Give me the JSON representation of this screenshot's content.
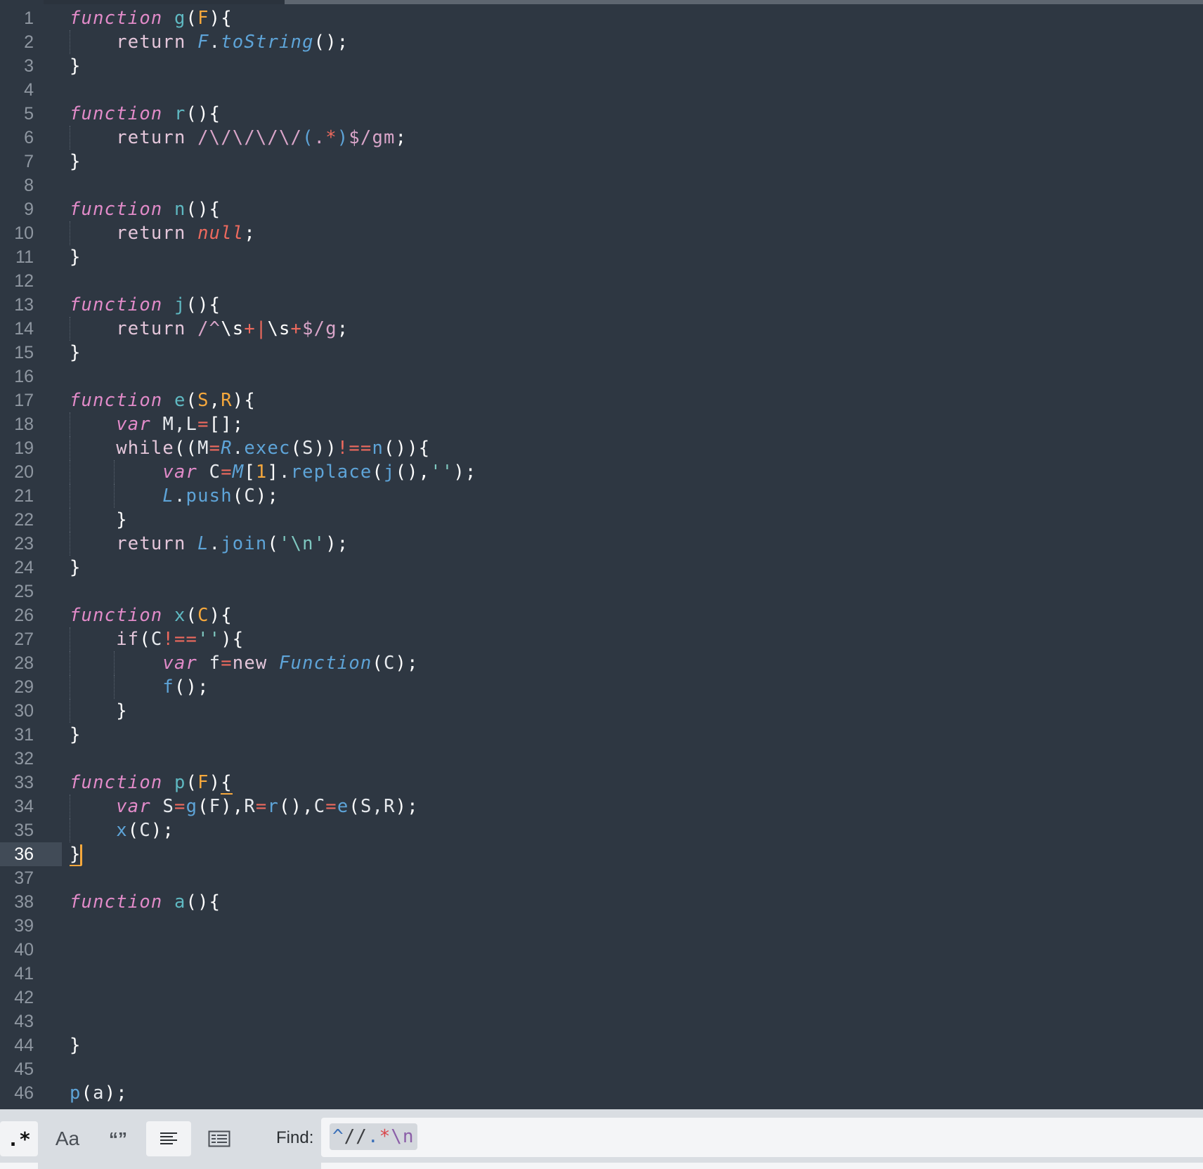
{
  "editor": {
    "active_line": "36",
    "lines": [
      {
        "n": "1"
      },
      {
        "n": "2"
      },
      {
        "n": "3"
      },
      {
        "n": "4"
      },
      {
        "n": "5"
      },
      {
        "n": "6"
      },
      {
        "n": "7"
      },
      {
        "n": "8"
      },
      {
        "n": "9"
      },
      {
        "n": "10"
      },
      {
        "n": "11"
      },
      {
        "n": "12"
      },
      {
        "n": "13"
      },
      {
        "n": "14"
      },
      {
        "n": "15"
      },
      {
        "n": "16"
      },
      {
        "n": "17"
      },
      {
        "n": "18"
      },
      {
        "n": "19"
      },
      {
        "n": "20"
      },
      {
        "n": "21"
      },
      {
        "n": "22"
      },
      {
        "n": "23"
      },
      {
        "n": "24"
      },
      {
        "n": "25"
      },
      {
        "n": "26"
      },
      {
        "n": "27"
      },
      {
        "n": "28"
      },
      {
        "n": "29"
      },
      {
        "n": "30"
      },
      {
        "n": "31"
      },
      {
        "n": "32"
      },
      {
        "n": "33"
      },
      {
        "n": "34"
      },
      {
        "n": "35"
      },
      {
        "n": "36"
      },
      {
        "n": "37"
      },
      {
        "n": "38"
      },
      {
        "n": "39"
      },
      {
        "n": "40"
      },
      {
        "n": "41"
      },
      {
        "n": "42"
      },
      {
        "n": "43"
      },
      {
        "n": "44"
      },
      {
        "n": "45"
      },
      {
        "n": "46"
      }
    ],
    "code": [
      "function g(F){",
      "    return F.toString();",
      "}",
      "",
      "function r(){",
      "    return /\\/\\/\\/\\/(.*)$/gm;",
      "}",
      "",
      "function n(){",
      "    return null;",
      "}",
      "",
      "function j(){",
      "    return /^\\s+|\\s+$/g;",
      "}",
      "",
      "function e(S,R){",
      "    var M,L=[];",
      "    while((M=R.exec(S))!==n()){",
      "        var C=M[1].replace(j(),'');",
      "        L.push(C);",
      "    }",
      "    return L.join('\\n');",
      "}",
      "",
      "function x(C){",
      "    if(C!==''){",
      "        var f=new Function(C);",
      "        f();",
      "    }",
      "}",
      "",
      "function p(F){",
      "    var S=g(F),R=r(),C=e(S,R);",
      "    x(C);",
      "}",
      "",
      "function a(){",
      "",
      "",
      "",
      "",
      "",
      "}",
      "",
      "p(a);"
    ]
  },
  "findbar": {
    "regex_toggle": ".*",
    "case_toggle": "Aa",
    "whole_word_toggle": "“”",
    "find_label": "Find:",
    "find_value": "^//.*\\n",
    "colors": {
      "background": "#d9dde2",
      "input": "#f4f5f7"
    }
  },
  "colors": {
    "editor_bg": "#2e3742",
    "keyword": "#e28bc9",
    "function_name": "#5fb9c2",
    "parameter": "#f6a83c",
    "operator": "#ee6a5e",
    "caret": "#f6a83c"
  }
}
